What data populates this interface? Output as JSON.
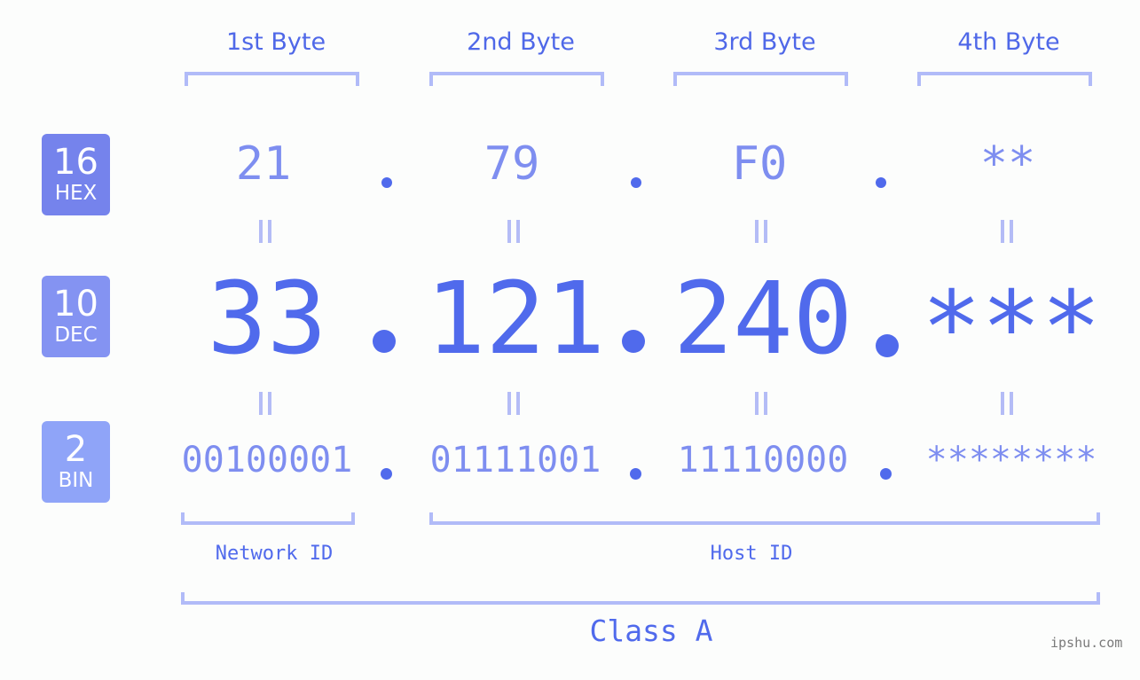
{
  "bytes": [
    {
      "label": "1st Byte",
      "hex": "21",
      "dec": "33",
      "bin": "00100001"
    },
    {
      "label": "2nd Byte",
      "hex": "79",
      "dec": "121",
      "bin": "01111001"
    },
    {
      "label": "3rd Byte",
      "hex": "F0",
      "dec": "240",
      "bin": "11110000"
    },
    {
      "label": "4th Byte",
      "hex": "**",
      "dec": "***",
      "bin": "********"
    }
  ],
  "badges": {
    "hex": {
      "num": "16",
      "label": "HEX",
      "color": "#7583ec"
    },
    "dec": {
      "num": "10",
      "label": "DEC",
      "color": "#8493f2"
    },
    "bin": {
      "num": "2",
      "label": "BIN",
      "color": "#8fa4f8"
    }
  },
  "sections": {
    "network_id": "Network ID",
    "host_id": "Host ID",
    "class": "Class A"
  },
  "watermark": "ipshu.com",
  "colors": {
    "primary": "#506aec",
    "light": "#7e8ef0",
    "bracket": "#b1bbf8"
  }
}
